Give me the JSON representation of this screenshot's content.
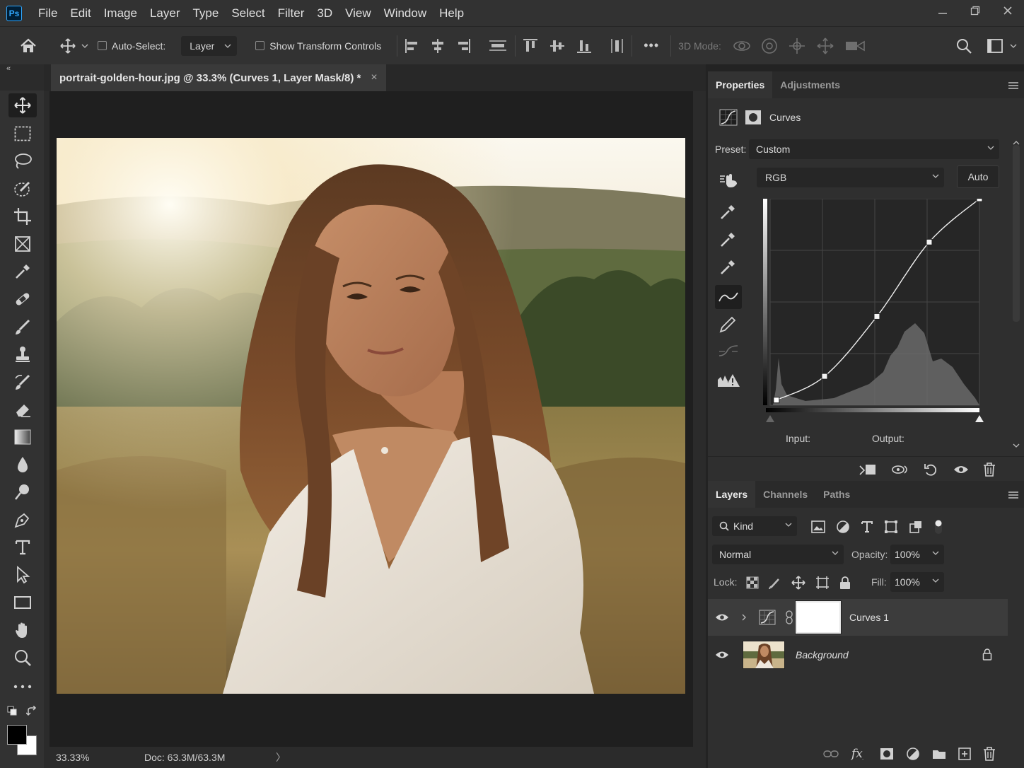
{
  "app": {
    "logo": "Ps"
  },
  "menu": [
    "File",
    "Edit",
    "Image",
    "Layer",
    "Type",
    "Select",
    "Filter",
    "3D",
    "View",
    "Window",
    "Help"
  ],
  "options": {
    "auto_select_label": "Auto-Select:",
    "auto_select_target": "Layer",
    "show_transform_label": "Show Transform Controls",
    "more": "•••",
    "mode_3d_label": "3D Mode:"
  },
  "document": {
    "tab_title": "portrait-golden-hour.jpg @ 33.3% (Curves 1, Layer Mask/8) *",
    "close_glyph": "×"
  },
  "status": {
    "zoom": "33.33%",
    "doc": "Doc: 63.3M/63.3M",
    "arrow": "〉"
  },
  "properties": {
    "tabs": [
      "Properties",
      "Adjustments"
    ],
    "adjustment_name": "Curves",
    "preset_label": "Preset:",
    "preset_value": "Custom",
    "channel": "RGB",
    "auto_label": "Auto",
    "input_label": "Input:",
    "output_label": "Output:"
  },
  "curve_points": [
    [
      0.03,
      0.025
    ],
    [
      0.26,
      0.14
    ],
    [
      0.51,
      0.43
    ],
    [
      0.76,
      0.79
    ],
    [
      1.0,
      1.0
    ]
  ],
  "layers_panel": {
    "tabs": [
      "Layers",
      "Channels",
      "Paths"
    ],
    "filter_kind": "Kind",
    "blend_mode": "Normal",
    "opacity_label": "Opacity:",
    "opacity_value": "100%",
    "lock_label": "Lock:",
    "fill_label": "Fill:",
    "fill_value": "100%",
    "layers": [
      {
        "name": "Curves 1",
        "visible": true,
        "selected": true
      },
      {
        "name": "Background",
        "visible": true,
        "locked": true
      }
    ]
  },
  "colors": {
    "accent": "#31a8ff",
    "panel": "#2f2f2f",
    "canvas": "#1f1f1f",
    "selected_row": "#3c3c3c"
  }
}
